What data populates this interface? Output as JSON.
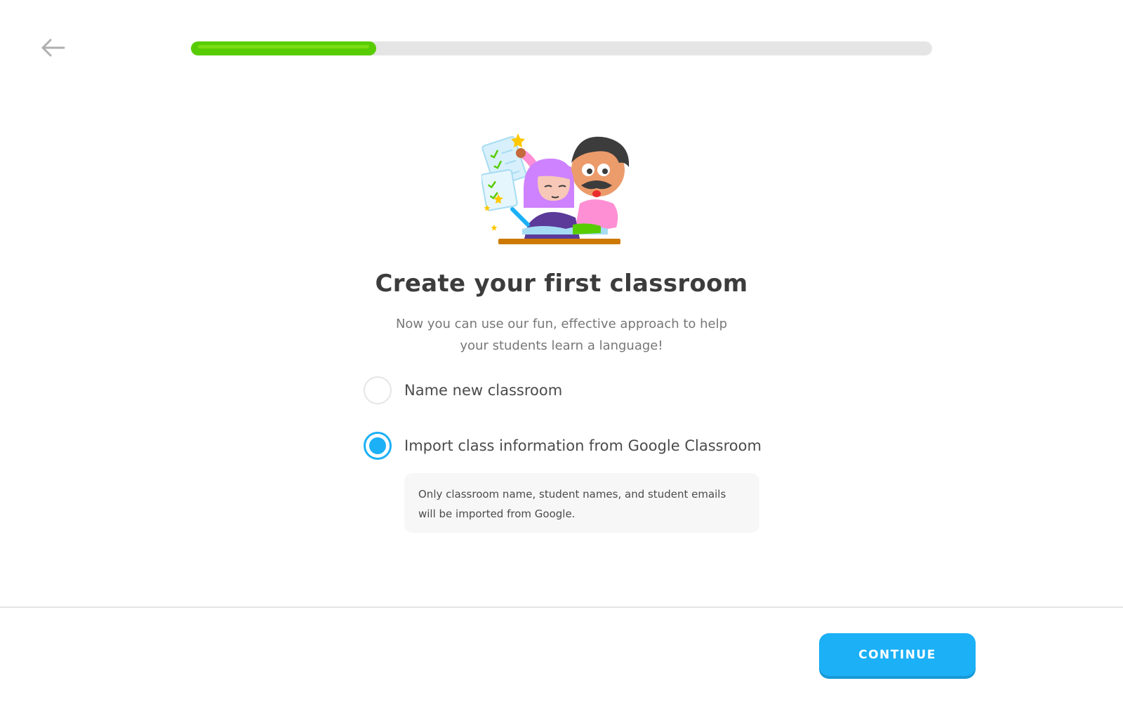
{
  "header": {
    "back_icon": "arrow-left-icon",
    "progress_percent": 25
  },
  "main": {
    "title": "Create your first classroom",
    "subtitle": "Now you can use our fun, effective approach to help your students learn a language!",
    "options": [
      {
        "label": "Name new classroom",
        "selected": false
      },
      {
        "label": "Import class information from Google Classroom",
        "selected": true
      }
    ],
    "info_text": "Only classroom name, student names, and student emails will be imported from Google."
  },
  "footer": {
    "continue_label": "CONTINUE"
  },
  "colors": {
    "accent_blue": "#1cb0f6",
    "progress_green": "#58cc02",
    "progress_track": "#e5e5e5"
  }
}
